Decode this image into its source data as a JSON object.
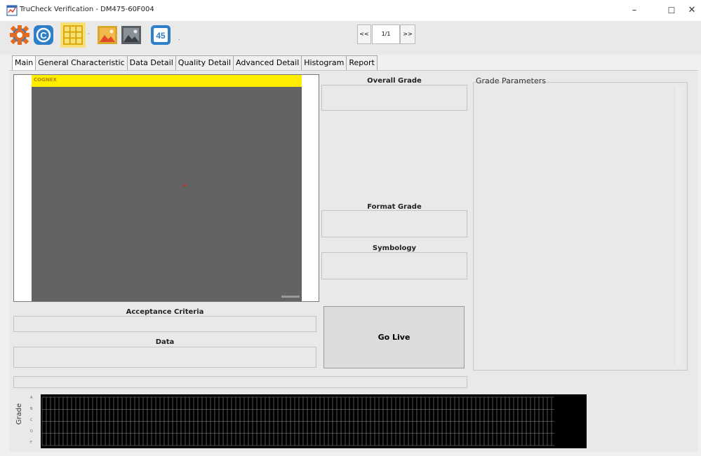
{
  "window": {
    "title": "TruCheck Verification - DM475-60F004",
    "minimize": "–",
    "maximize": "☐",
    "close": "✕"
  },
  "toolbar": {
    "buttons": [
      "settings-icon",
      "cognex-icon",
      "grid-icon",
      "image-color-icon",
      "image-mono-icon",
      "rotate-45-icon"
    ],
    "rotate_label": "45"
  },
  "pager": {
    "prev": "<<",
    "position": "1/1",
    "next": ">>"
  },
  "tabs": [
    "Main",
    "General Characteristic",
    "Data Detail",
    "Quality Detail",
    "Advanced Detail",
    "Histogram",
    "Report"
  ],
  "image": {
    "brand": "COGNEX"
  },
  "fields": {
    "overall_grade": "Overall Grade",
    "format_grade": "Format Grade",
    "symbology": "Symbology",
    "acceptance_criteria": "Acceptance Criteria",
    "data": "Data"
  },
  "go_live": "Go Live",
  "grade_parameters": "Grade Parameters",
  "grade_chart": {
    "axis_title": "Grade",
    "ticks": [
      "A",
      "B",
      "C",
      "D",
      "F"
    ]
  },
  "colors": {
    "brand_yellow": "#ffee00",
    "image_gray": "#636363",
    "chart_background": "#000000"
  }
}
